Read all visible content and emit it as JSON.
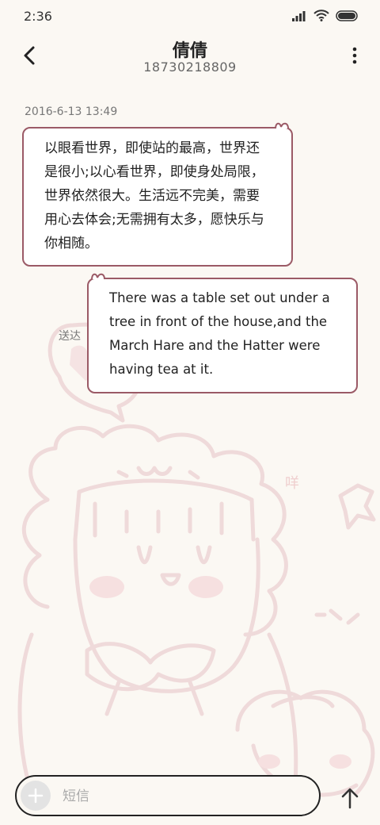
{
  "status_bar": {
    "time": "2:36"
  },
  "header": {
    "contact_name": "倩倩",
    "contact_number": "18730218809"
  },
  "conversation": {
    "timestamp": "2016-6-13 13:49",
    "messages": [
      {
        "direction": "incoming",
        "text": "以眼看世界，即使站的最高，世界还是很小;以心看世界，即使身处局限，世界依然很大。生活远不完美，需要用心去体会;无需拥有太多，愿快乐与你相随。"
      },
      {
        "direction": "outgoing",
        "text": "There was a table set out under a tree in front of the house,and the March Hare and the Hatter were having tea at it."
      }
    ],
    "delivery_status": "送达"
  },
  "background_art": {
    "text": "咩"
  },
  "composer": {
    "placeholder": "短信"
  },
  "colors": {
    "bubble_border": "#9b5a66",
    "background": "#fbf8f3",
    "art_line": "#efdada"
  }
}
